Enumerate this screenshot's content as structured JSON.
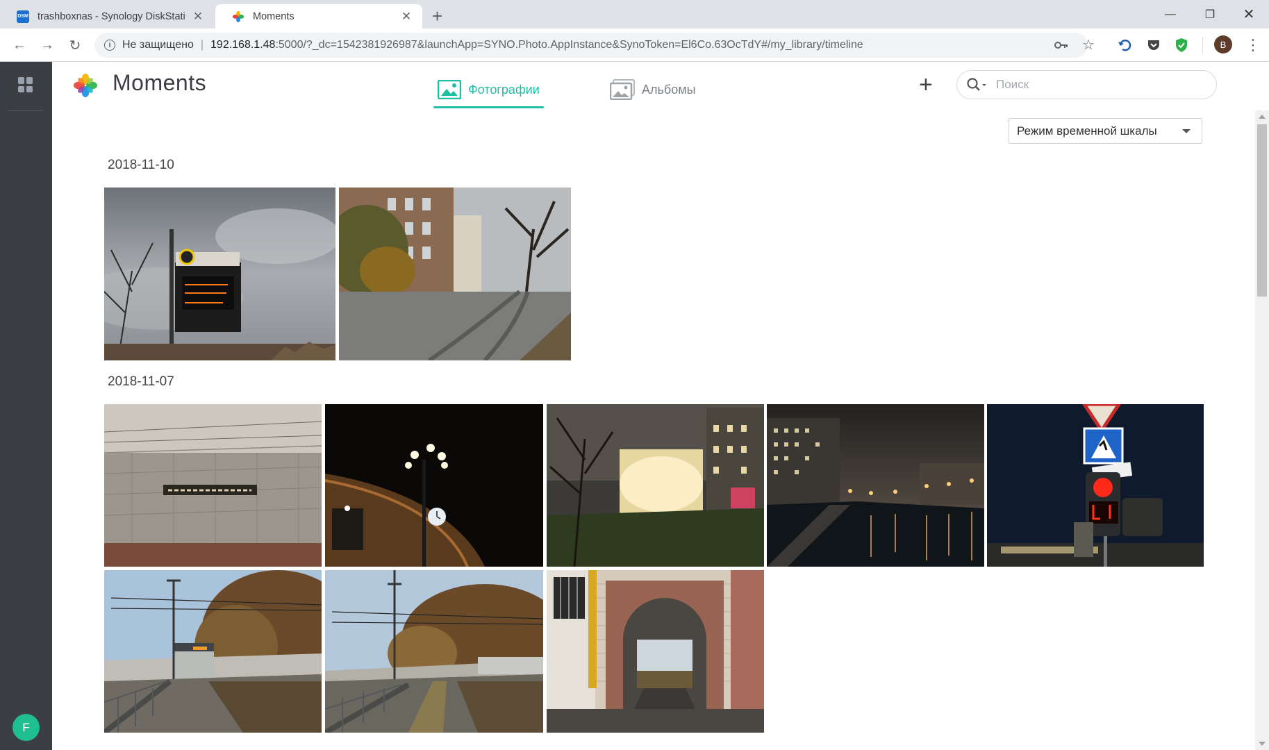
{
  "browser": {
    "tabs": [
      {
        "title": "trashboxnas - Synology DiskStati",
        "icon": "dsm-icon",
        "active": false
      },
      {
        "title": "Moments",
        "icon": "moments-icon",
        "active": true
      }
    ],
    "address": {
      "security_label": "Не защищено",
      "host": "192.168.1.48",
      "path": ":5000/?_dc=1542381926987&launchApp=SYNO.Photo.AppInstance&SynoToken=El6Co.63OcTdY#/my_library/timeline"
    },
    "profile_initial": "B"
  },
  "dsm": {
    "user_initial": "F"
  },
  "app": {
    "name": "Moments",
    "tabs": {
      "photos": "Фотографии",
      "albums": "Альбомы"
    },
    "search_placeholder": "Поиск",
    "view_mode": "Режим временной шкалы"
  },
  "timeline": [
    {
      "date": "2018-11-10",
      "photos": [
        "bus-stop-sign",
        "tram-street"
      ]
    },
    {
      "date": "2018-11-07",
      "photos": [
        "metro-wall-sign",
        "night-street-lamp",
        "night-lit-building",
        "night-river",
        "traffic-light-stop",
        "tram-avenue",
        "tram-tracks-trees",
        "brick-archway"
      ]
    }
  ],
  "colors": {
    "accent": "#1ec0a3",
    "rail": "#3b3e43",
    "user_avatar": "#1fbf8f"
  }
}
